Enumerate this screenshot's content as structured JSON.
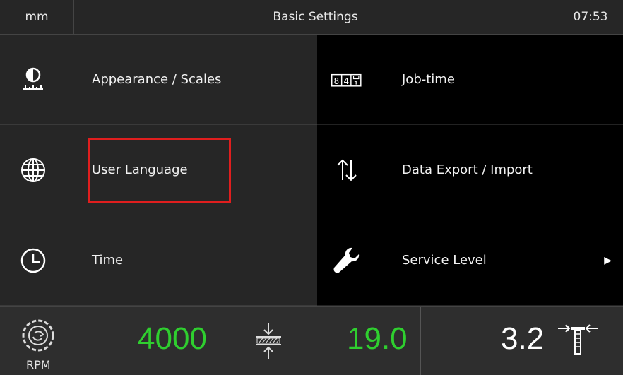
{
  "header": {
    "unit": "mm",
    "title": "Basic Settings",
    "time": "07:53"
  },
  "menu_left": [
    {
      "label": "Appearance / Scales",
      "icon": "appearance-scales-icon"
    },
    {
      "label": "User Language",
      "icon": "globe-icon"
    },
    {
      "label": "Time",
      "icon": "clock-icon"
    }
  ],
  "menu_right": [
    {
      "label": "Job-time",
      "icon": "job-time-counter-icon",
      "icon_text": "84"
    },
    {
      "label": "Data Export / Import",
      "icon": "transfer-arrows-icon"
    },
    {
      "label": "Service Level",
      "icon": "wrench-icon",
      "has_submenu": true
    }
  ],
  "footer": {
    "rpm_label": "RPM",
    "rpm_value": "4000",
    "thickness_value": "19.0",
    "cut_value": "3.2"
  },
  "colors": {
    "accent_green": "#2fcf2f",
    "highlight_red": "#e01e1e"
  }
}
